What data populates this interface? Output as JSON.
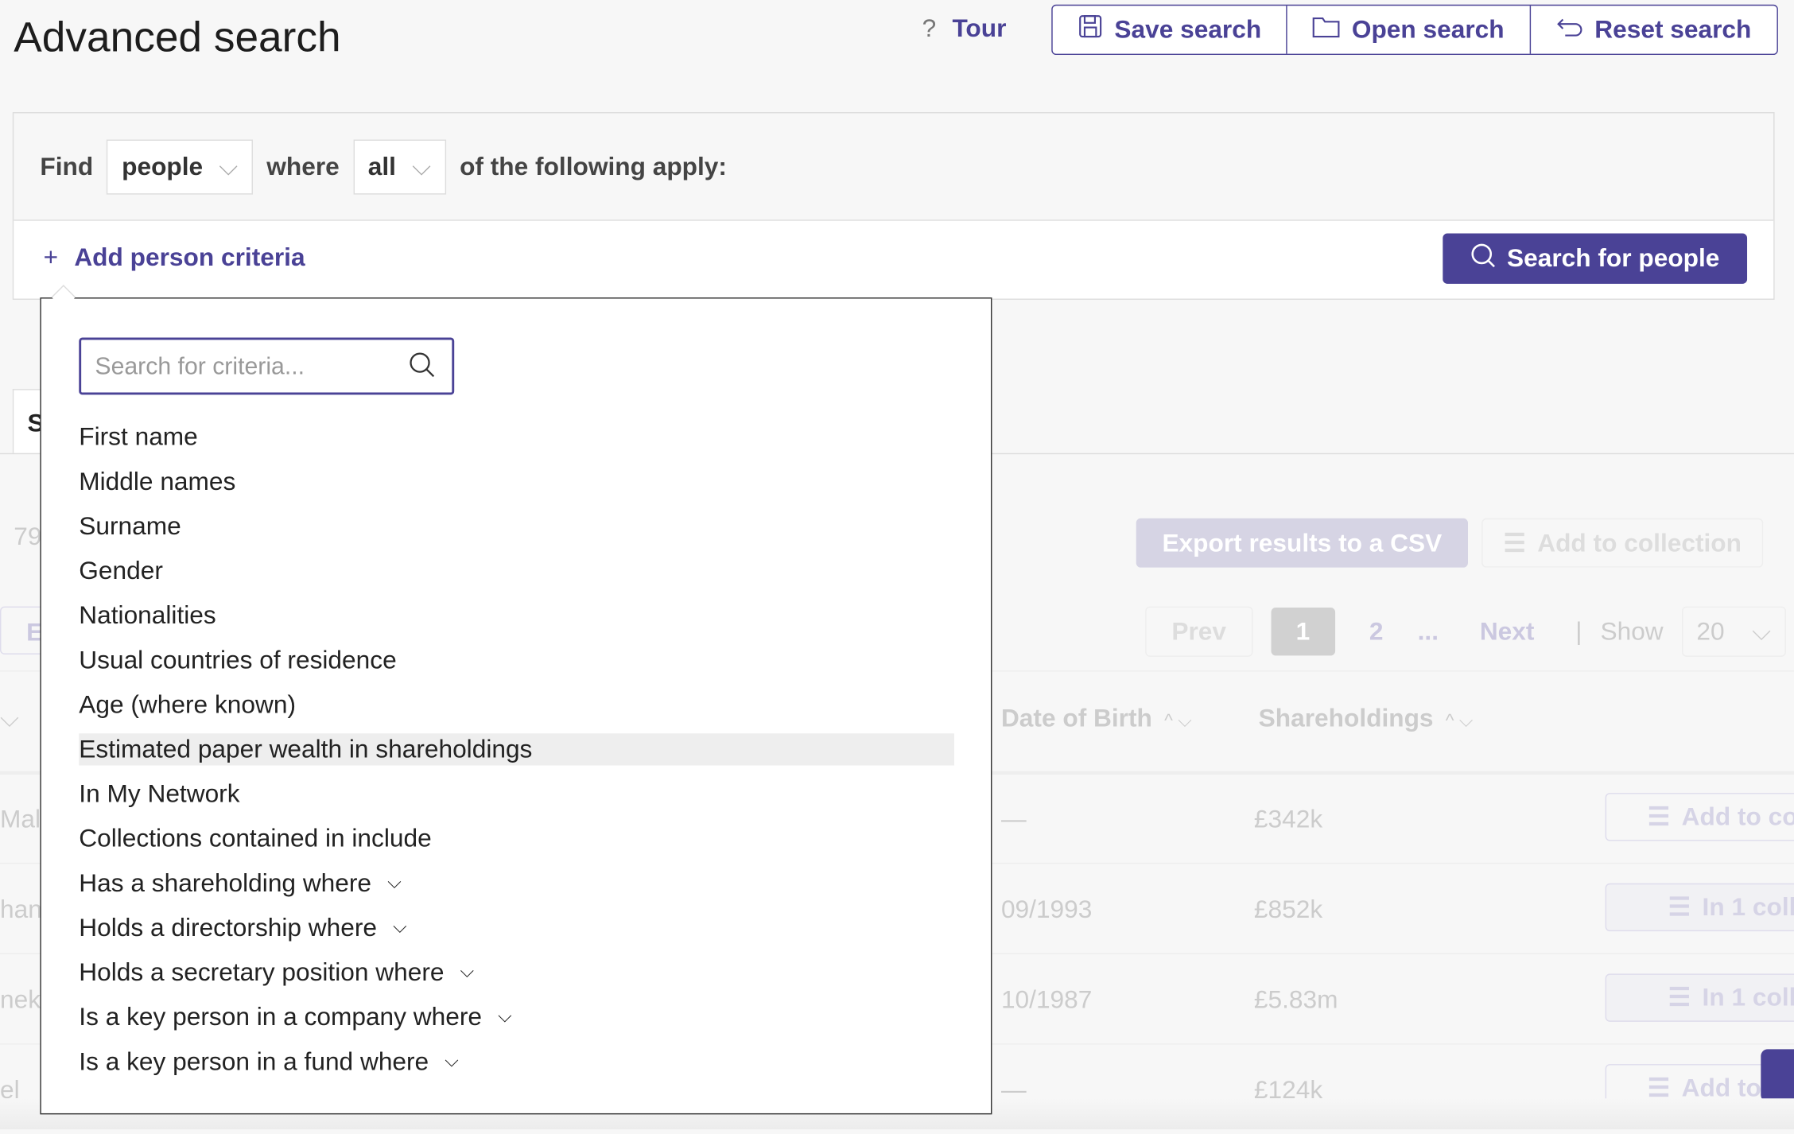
{
  "header": {
    "title": "Advanced search",
    "tour": "Tour",
    "save_search": "Save search",
    "open_search": "Open search",
    "reset_search": "Reset search"
  },
  "query": {
    "find_label": "Find",
    "entity": "people",
    "where_label": "where",
    "match": "all",
    "suffix": "of the following apply:",
    "add_criteria": "Add person criteria",
    "search_button": "Search for people"
  },
  "dropdown": {
    "search_placeholder": "Search for criteria...",
    "options": [
      {
        "label": "First name",
        "expandable": false
      },
      {
        "label": "Middle names",
        "expandable": false
      },
      {
        "label": "Surname",
        "expandable": false
      },
      {
        "label": "Gender",
        "expandable": false
      },
      {
        "label": "Nationalities",
        "expandable": false
      },
      {
        "label": "Usual countries of residence",
        "expandable": false
      },
      {
        "label": "Age (where known)",
        "expandable": false
      },
      {
        "label": "Estimated paper wealth in shareholdings",
        "expandable": false,
        "highlighted": true
      },
      {
        "label": "In My Network",
        "expandable": false
      },
      {
        "label": "Collections contained in include",
        "expandable": false
      },
      {
        "label": "Has a shareholding where",
        "expandable": true
      },
      {
        "label": "Holds a directorship where",
        "expandable": true
      },
      {
        "label": "Holds a secretary position where",
        "expandable": true
      },
      {
        "label": "Is a key person in a company where",
        "expandable": true
      },
      {
        "label": "Is a key person in a fund where",
        "expandable": true
      }
    ]
  },
  "background": {
    "tab_partial": "S",
    "count_partial": "79",
    "button_partial": "E",
    "export_csv": "Export results to a CSV",
    "add_to_collection": "Add to collection",
    "pagination": {
      "prev": "Prev",
      "current": "1",
      "next_page": "2",
      "ellipsis": "...",
      "next": "Next",
      "show_label": "Show",
      "page_size": "20"
    },
    "columns": [
      "Date of Birth",
      "Shareholdings"
    ],
    "rows": [
      {
        "name_partial": "Malc",
        "dob": "—",
        "shareholdings": "£342k",
        "action": "Add to co"
      },
      {
        "name_partial": "han",
        "dob": "09/1993",
        "shareholdings": "£852k",
        "action": "In 1 coll"
      },
      {
        "name_partial": "nek",
        "dob": "10/1987",
        "shareholdings": "£5.83m",
        "action": "In 1 coll"
      },
      {
        "name_partial": "el",
        "dob": "—",
        "shareholdings": "£124k",
        "action": "Add to"
      }
    ]
  },
  "colors": {
    "accent": "#4a4296"
  }
}
